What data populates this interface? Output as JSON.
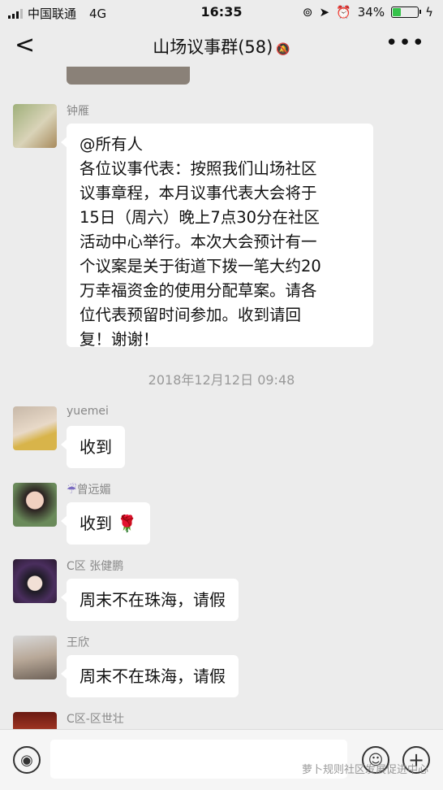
{
  "status": {
    "carrier": "中国联通",
    "network": "4G",
    "time": "16:35",
    "battery": "34%",
    "battery_level": 0.34,
    "battery_color": "#35c24a"
  },
  "header": {
    "back_glyph": "<",
    "title": "山场议事群(58)",
    "more_glyph": "•••"
  },
  "messages": [
    {
      "sender": "钟雁",
      "lines": [
        "@所有人",
        "各位议事代表：按照我们山场社区",
        "议事章程，本月议事代表大会将于",
        "15日（周六）晚上7点30分在社区",
        "活动中心举行。本次大会预计有一",
        "个议案是关于街道下拨一笔大约20",
        "万幸福资金的使用分配草案。请各",
        "位代表预留时间参加。收到请回",
        "复！谢谢！"
      ]
    },
    {
      "sender": "yuemei",
      "text": "收到"
    },
    {
      "sender": "曾远媚",
      "text": "收到",
      "emoji": "🌹"
    },
    {
      "sender": "C区 张健鹏",
      "text": "周末不在珠海，请假"
    },
    {
      "sender": "王欣",
      "text": "周末不在珠海，请假"
    },
    {
      "sender": "C区-区世壮"
    }
  ],
  "timestamp": "2018年12月12日 09:48",
  "input": {
    "voice_icon": "voice-icon",
    "emoji_icon": "emoji-icon",
    "plus_icon": "plus-icon"
  },
  "watermark": "萝卜规则社区发展促进中心"
}
